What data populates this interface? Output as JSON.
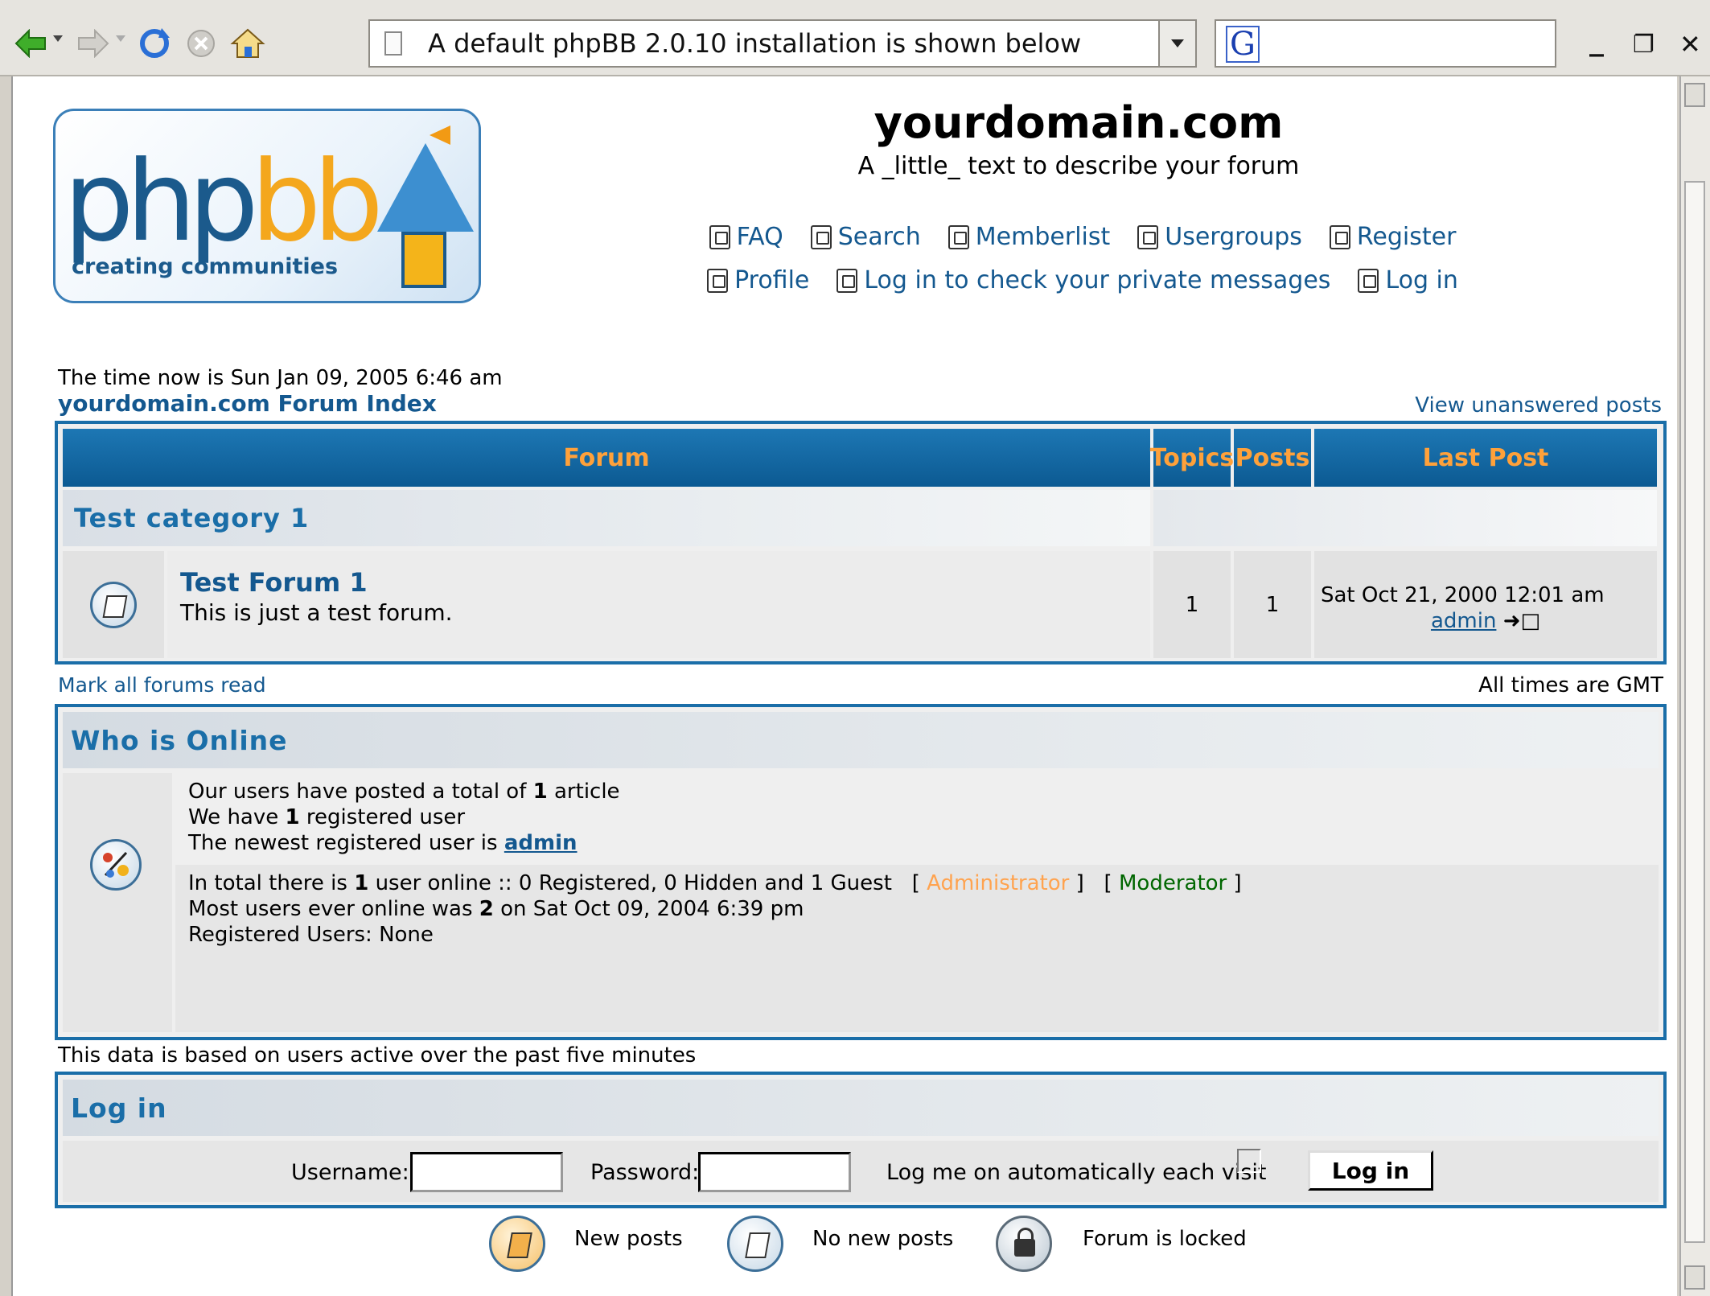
{
  "browser": {
    "address_text": "A default phpBB 2.0.10 installation is shown below",
    "search_engine_icon": "G",
    "win_min": "_",
    "win_restore": "❐",
    "win_close": "✕"
  },
  "header": {
    "logo_ph": "php",
    "logo_bb": "bb",
    "logo_tagline": "creating communities",
    "site_title": "yourdomain.com",
    "site_desc": "A _little_ text to describe your forum",
    "nav_row1": [
      "FAQ",
      "Search",
      "Memberlist",
      "Usergroups",
      "Register"
    ],
    "nav_row2": [
      "Profile",
      "Log in to check your private messages",
      "Log in"
    ]
  },
  "time_now": "The time now is Sun Jan 09, 2005 6:46 am",
  "forum_index_link": "yourdomain.com Forum Index",
  "view_unanswered": "View unanswered posts",
  "forum_table": {
    "headers": {
      "forum": "Forum",
      "topics": "Topics",
      "posts": "Posts",
      "last_post": "Last Post"
    },
    "category": "Test category 1",
    "forums": [
      {
        "name": "Test Forum 1",
        "description": "This is just a test forum.",
        "topics": "1",
        "posts": "1",
        "last_post_date": "Sat Oct 21, 2000 12:01 am",
        "last_post_user": "admin"
      }
    ]
  },
  "mark_read": "Mark all forums read",
  "all_times": "All times are GMT",
  "online": {
    "title": "Who is Online",
    "line1_a": "Our users have posted a total of ",
    "line1_b": "1",
    "line1_c": " article",
    "line2_a": "We have ",
    "line2_b": "1",
    "line2_c": " registered user",
    "line3_a": "The newest registered user is ",
    "line3_user": "admin",
    "line4_a": "In total there is ",
    "line4_b": "1",
    "line4_c": " user online :: 0 Registered, 0 Hidden and 1 Guest   [ ",
    "line4_admin": "Administrator",
    "line4_d": " ]   [ ",
    "line4_mod": "Moderator",
    "line4_e": " ]",
    "line5_a": "Most users ever online was ",
    "line5_b": "2",
    "line5_c": " on Sat Oct 09, 2004 6:39 pm",
    "line6": "Registered Users: None"
  },
  "data_note": "This data is based on users active over the past five minutes",
  "login": {
    "title": "Log in",
    "username_label": "Username:",
    "password_label": "Password:",
    "auto_label": "Log me on automatically each visit",
    "button": "Log in"
  },
  "legend": {
    "new_posts": "New posts",
    "no_new_posts": "No new posts",
    "locked": "Forum is locked"
  },
  "colors": {
    "link": "#14588f",
    "header_bar": "#1d77b4",
    "header_text": "#ffa13a",
    "administrator": "#ffa34f",
    "moderator": "#006600"
  }
}
